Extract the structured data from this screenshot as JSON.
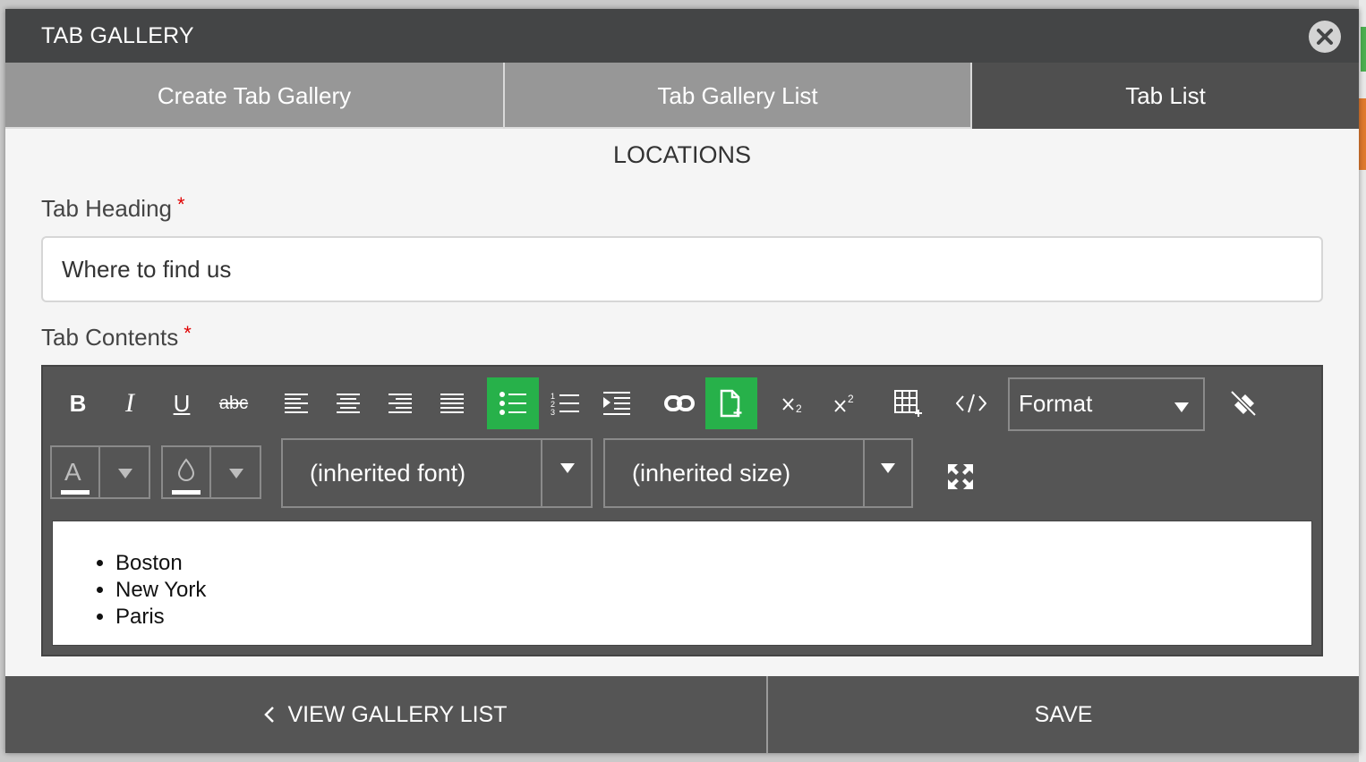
{
  "modal": {
    "title": "TAB GALLERY"
  },
  "tabs": [
    {
      "label": "Create Tab Gallery",
      "active": false
    },
    {
      "label": "Tab Gallery List",
      "active": false
    },
    {
      "label": "Tab List",
      "active": true
    }
  ],
  "section_title": "LOCATIONS",
  "form": {
    "heading_label": "Tab Heading",
    "heading_value": "Where to find us",
    "contents_label": "Tab Contents",
    "required_marker": "*"
  },
  "toolbar": {
    "bold": "B",
    "italic": "I",
    "underline": "U",
    "strikethrough": "abc",
    "subscript_icon": "subscript-icon",
    "superscript_icon": "superscript-icon",
    "format_label": "Format",
    "font_label": "(inherited font)",
    "size_label": "(inherited size)",
    "text_color_letter": "A",
    "active_color": "#27b14a"
  },
  "content": {
    "list_items": [
      "Boston",
      "New York",
      "Paris"
    ]
  },
  "footer": {
    "back_label": "VIEW GALLERY LIST",
    "save_label": "SAVE"
  }
}
